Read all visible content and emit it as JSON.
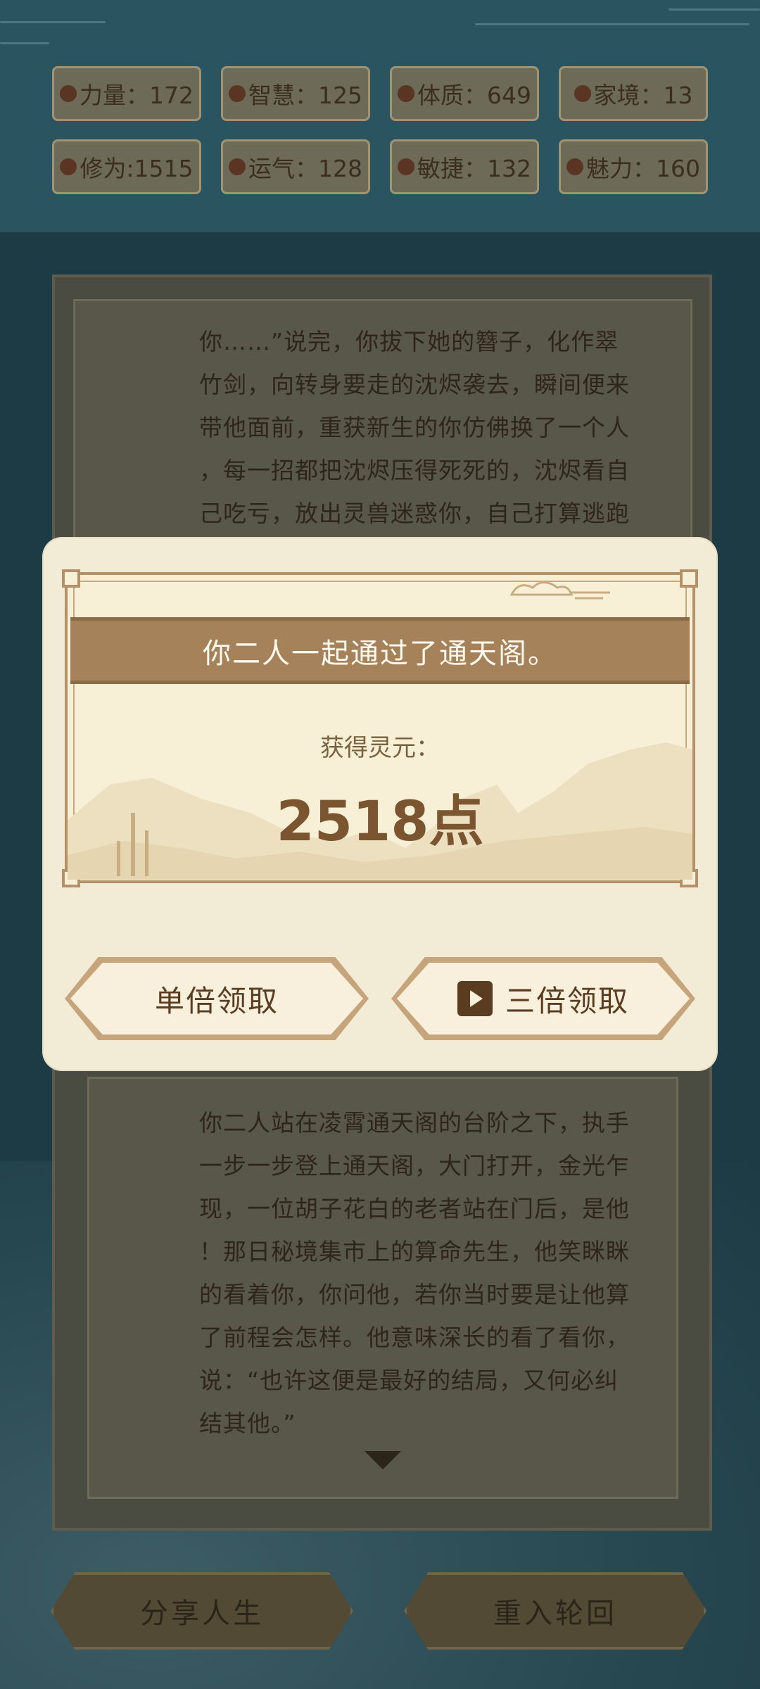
{
  "stats": [
    {
      "icon": "strength-icon",
      "label": "力量：172"
    },
    {
      "icon": "wisdom-icon",
      "label": "智慧：125"
    },
    {
      "icon": "constitution-icon",
      "label": "体质：649"
    },
    {
      "icon": "family-icon",
      "label": "家境：13"
    },
    {
      "icon": "cultivation-icon",
      "label": "修为:1515"
    },
    {
      "icon": "luck-icon",
      "label": "运气：128"
    },
    {
      "icon": "agility-icon",
      "label": "敏捷：132"
    },
    {
      "icon": "charm-icon",
      "label": "魅力：160"
    }
  ],
  "story_top": [
    "你……”说完，你拔下她的簪子，化作翠",
    "竹剑，向转身要走的沈烬袭去，瞬间便来",
    "带他面前，重获新生的你仿佛换了一个人",
    "，每一招都把沈烬压得死死的，沈烬看自",
    "己吃亏，放出灵兽迷惑你，自己打算逃跑"
  ],
  "story_bottom": [
    "你二人站在凌霄通天阁的台阶之下，执手",
    "一步一步登上通天阁，大门打开，金光乍",
    "现，一位胡子花白的老者站在门后，是他",
    "！那日秘境集市上的算命先生，他笑眯眯",
    "的看着你，你问他，若你当时要是让他算",
    "了前程会怎样。他意味深长的看了看你，",
    "说：“也许这便是最好的结局，又何必纠",
    "结其他。”"
  ],
  "modal": {
    "title": "你二人一起通过了通天阁。",
    "reward_label": "获得灵元：",
    "reward_value": "2518点",
    "single_button": "单倍领取",
    "triple_button": "三倍领取"
  },
  "bottom_buttons": {
    "share": "分享人生",
    "restart": "重入轮回"
  },
  "colors": {
    "modal_bg": "#f2ebd6",
    "banner": "#a5825a",
    "button_text": "#5a3d20"
  }
}
